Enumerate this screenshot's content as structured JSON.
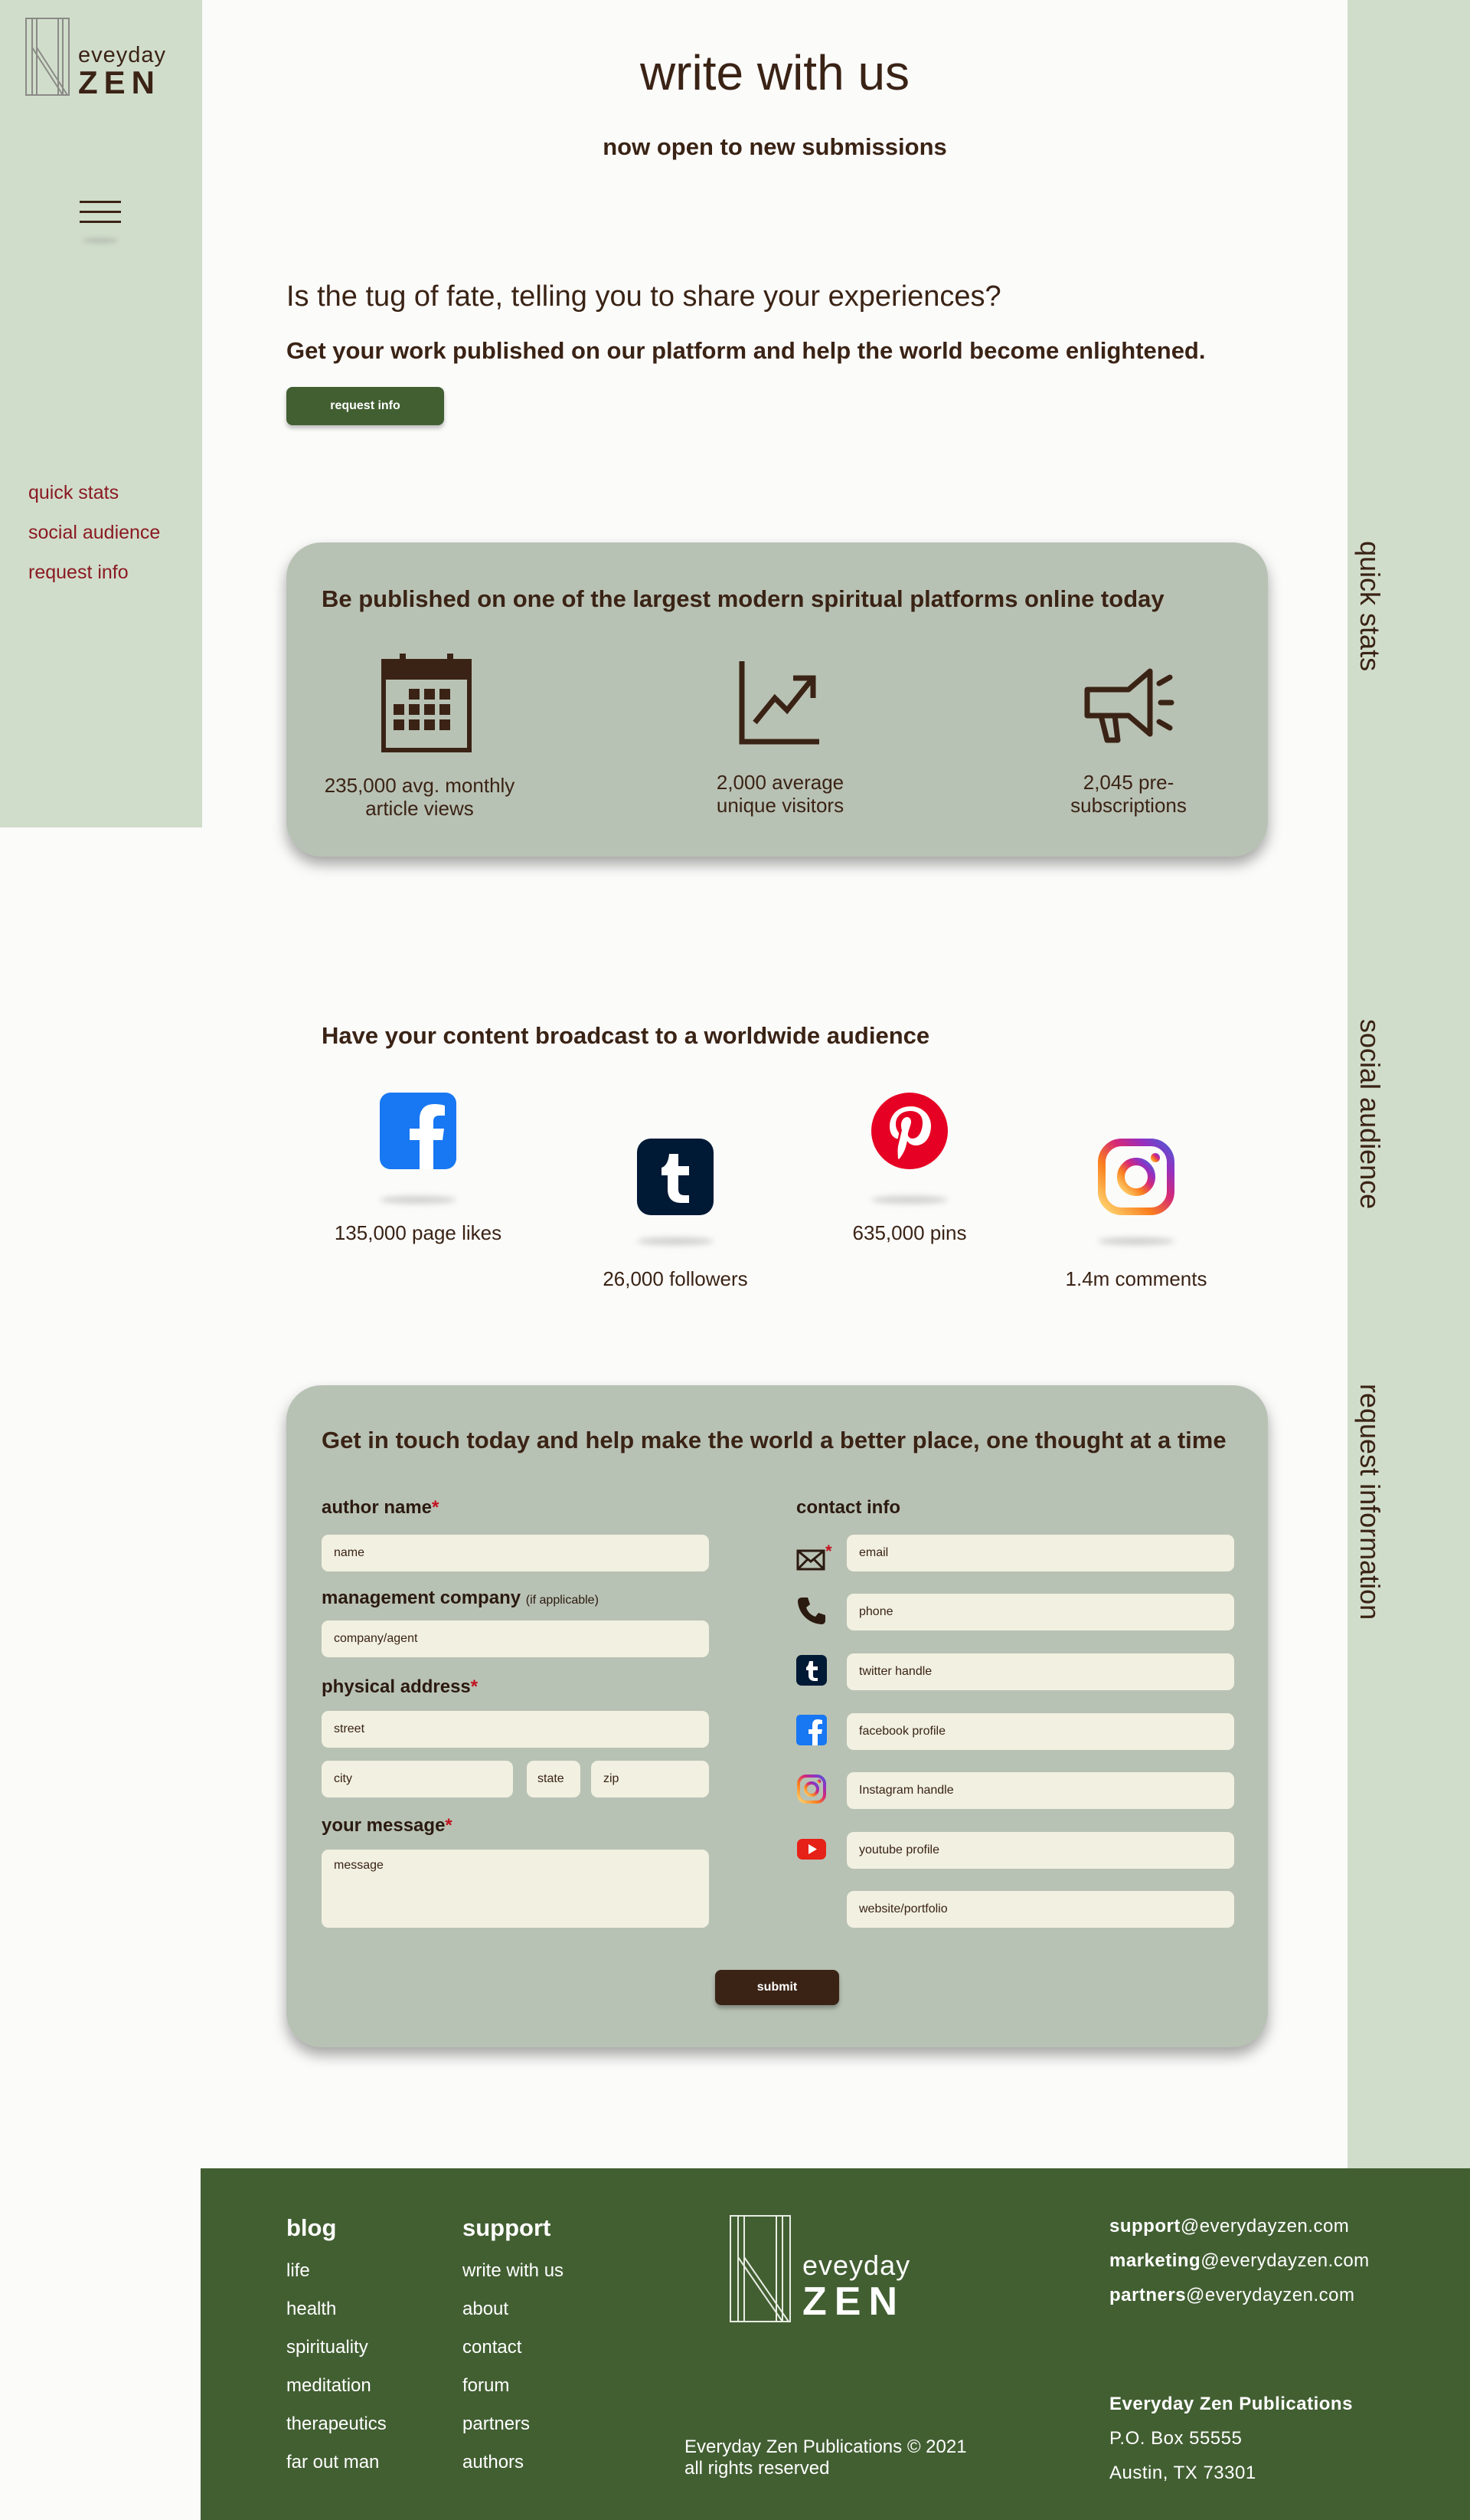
{
  "brand": {
    "logo_top": "eveyday",
    "logo_bottom": "ZEN"
  },
  "sidebar": {
    "nav": [
      {
        "label": "quick stats"
      },
      {
        "label": "social audience"
      },
      {
        "label": "request info"
      }
    ]
  },
  "right_labels": [
    "quick stats",
    "social audience",
    "request information"
  ],
  "header": {
    "title": "write with us",
    "subtitle": "now open to new submissions"
  },
  "intro": {
    "question": "Is the tug of fate, telling you to share your experiences?",
    "lead": "Get your work published on our platform and help the world become enlightened.",
    "button": "request info"
  },
  "stats": {
    "title": "Be published on one of the largest modern spiritual platforms online today",
    "items": [
      {
        "icon": "calendar-icon",
        "line1": "235,000 avg. monthly",
        "line2": "article views"
      },
      {
        "icon": "chart-up-icon",
        "line1": "2,000 average",
        "line2": "unique visitors"
      },
      {
        "icon": "megaphone-icon",
        "line1": "2,045 pre-",
        "line2": "subscriptions"
      }
    ]
  },
  "social": {
    "title": "Have your content broadcast to a worldwide audience",
    "items": [
      {
        "icon": "facebook-icon",
        "label": "135,000 page likes",
        "color": "#1877f2"
      },
      {
        "icon": "tumblr-icon",
        "label": "26,000 followers",
        "color": "#001935"
      },
      {
        "icon": "pinterest-icon",
        "label": "635,000 pins",
        "color": "#e60023"
      },
      {
        "icon": "instagram-icon",
        "label": "1.4m comments",
        "color": "#c13584"
      }
    ]
  },
  "form": {
    "title": "Get in touch today and help make the world a better place, one thought at a time",
    "author_label": "author name",
    "author_placeholder": "name",
    "company_label": "management company",
    "company_note": "(if applicable)",
    "company_placeholder": "company/agent",
    "address_label": "physical address",
    "street_placeholder": "street",
    "city_placeholder": "city",
    "state_placeholder": "state",
    "zip_placeholder": "zip",
    "message_label": "your message",
    "message_placeholder": "message",
    "required_mark": "*",
    "contact_label": "contact info",
    "contact_fields": [
      {
        "icon": "envelope-icon",
        "placeholder": "email"
      },
      {
        "icon": "phone-icon",
        "placeholder": "phone"
      },
      {
        "icon": "tumblr-icon",
        "placeholder": "twitter handle"
      },
      {
        "icon": "facebook-icon",
        "placeholder": "facebook profile"
      },
      {
        "icon": "instagram-icon",
        "placeholder": "Instagram handle"
      },
      {
        "icon": "youtube-icon",
        "placeholder": "youtube profile"
      },
      {
        "icon": "",
        "placeholder": "website/portfolio"
      }
    ],
    "submit": "submit"
  },
  "footer": {
    "blog_title": "blog",
    "blog_links": [
      "life",
      "health",
      "spirituality",
      "meditation",
      "therapeutics",
      "far out man"
    ],
    "support_title": "support",
    "support_links": [
      "write with us",
      "about",
      "contact",
      "forum",
      "partners",
      "authors"
    ],
    "copyright_line1": "Everyday Zen Publications © 2021",
    "copyright_line2": "all rights reserved",
    "emails": [
      {
        "name": "support",
        "domain": "@everydayzen.com"
      },
      {
        "name": "marketing",
        "domain": "@everydayzen.com"
      },
      {
        "name": "partners",
        "domain": "@everydayzen.com"
      }
    ],
    "company": "Everyday Zen Publications",
    "address_line1": "P.O. Box 55555",
    "address_line2": "Austin, TX 73301"
  },
  "colors": {
    "sage": "#d1ddcb",
    "card": "#b8c2b4",
    "forest": "#425f32",
    "brown": "#3a2315",
    "link_red": "#8a1a22",
    "input": "#f1f0e1"
  }
}
